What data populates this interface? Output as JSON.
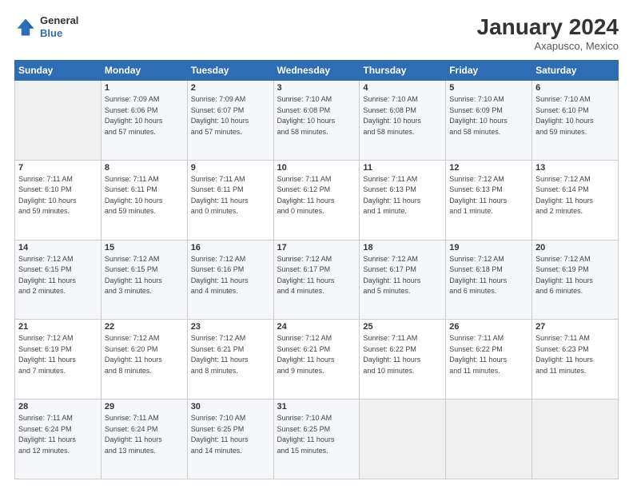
{
  "header": {
    "logo_general": "General",
    "logo_blue": "Blue",
    "month_title": "January 2024",
    "location": "Axapusco, Mexico"
  },
  "days_of_week": [
    "Sunday",
    "Monday",
    "Tuesday",
    "Wednesday",
    "Thursday",
    "Friday",
    "Saturday"
  ],
  "weeks": [
    [
      {
        "num": "",
        "info": ""
      },
      {
        "num": "1",
        "info": "Sunrise: 7:09 AM\nSunset: 6:06 PM\nDaylight: 10 hours\nand 57 minutes."
      },
      {
        "num": "2",
        "info": "Sunrise: 7:09 AM\nSunset: 6:07 PM\nDaylight: 10 hours\nand 57 minutes."
      },
      {
        "num": "3",
        "info": "Sunrise: 7:10 AM\nSunset: 6:08 PM\nDaylight: 10 hours\nand 58 minutes."
      },
      {
        "num": "4",
        "info": "Sunrise: 7:10 AM\nSunset: 6:08 PM\nDaylight: 10 hours\nand 58 minutes."
      },
      {
        "num": "5",
        "info": "Sunrise: 7:10 AM\nSunset: 6:09 PM\nDaylight: 10 hours\nand 58 minutes."
      },
      {
        "num": "6",
        "info": "Sunrise: 7:10 AM\nSunset: 6:10 PM\nDaylight: 10 hours\nand 59 minutes."
      }
    ],
    [
      {
        "num": "7",
        "info": "Sunrise: 7:11 AM\nSunset: 6:10 PM\nDaylight: 10 hours\nand 59 minutes."
      },
      {
        "num": "8",
        "info": "Sunrise: 7:11 AM\nSunset: 6:11 PM\nDaylight: 10 hours\nand 59 minutes."
      },
      {
        "num": "9",
        "info": "Sunrise: 7:11 AM\nSunset: 6:11 PM\nDaylight: 11 hours\nand 0 minutes."
      },
      {
        "num": "10",
        "info": "Sunrise: 7:11 AM\nSunset: 6:12 PM\nDaylight: 11 hours\nand 0 minutes."
      },
      {
        "num": "11",
        "info": "Sunrise: 7:11 AM\nSunset: 6:13 PM\nDaylight: 11 hours\nand 1 minute."
      },
      {
        "num": "12",
        "info": "Sunrise: 7:12 AM\nSunset: 6:13 PM\nDaylight: 11 hours\nand 1 minute."
      },
      {
        "num": "13",
        "info": "Sunrise: 7:12 AM\nSunset: 6:14 PM\nDaylight: 11 hours\nand 2 minutes."
      }
    ],
    [
      {
        "num": "14",
        "info": "Sunrise: 7:12 AM\nSunset: 6:15 PM\nDaylight: 11 hours\nand 2 minutes."
      },
      {
        "num": "15",
        "info": "Sunrise: 7:12 AM\nSunset: 6:15 PM\nDaylight: 11 hours\nand 3 minutes."
      },
      {
        "num": "16",
        "info": "Sunrise: 7:12 AM\nSunset: 6:16 PM\nDaylight: 11 hours\nand 4 minutes."
      },
      {
        "num": "17",
        "info": "Sunrise: 7:12 AM\nSunset: 6:17 PM\nDaylight: 11 hours\nand 4 minutes."
      },
      {
        "num": "18",
        "info": "Sunrise: 7:12 AM\nSunset: 6:17 PM\nDaylight: 11 hours\nand 5 minutes."
      },
      {
        "num": "19",
        "info": "Sunrise: 7:12 AM\nSunset: 6:18 PM\nDaylight: 11 hours\nand 6 minutes."
      },
      {
        "num": "20",
        "info": "Sunrise: 7:12 AM\nSunset: 6:19 PM\nDaylight: 11 hours\nand 6 minutes."
      }
    ],
    [
      {
        "num": "21",
        "info": "Sunrise: 7:12 AM\nSunset: 6:19 PM\nDaylight: 11 hours\nand 7 minutes."
      },
      {
        "num": "22",
        "info": "Sunrise: 7:12 AM\nSunset: 6:20 PM\nDaylight: 11 hours\nand 8 minutes."
      },
      {
        "num": "23",
        "info": "Sunrise: 7:12 AM\nSunset: 6:21 PM\nDaylight: 11 hours\nand 8 minutes."
      },
      {
        "num": "24",
        "info": "Sunrise: 7:12 AM\nSunset: 6:21 PM\nDaylight: 11 hours\nand 9 minutes."
      },
      {
        "num": "25",
        "info": "Sunrise: 7:11 AM\nSunset: 6:22 PM\nDaylight: 11 hours\nand 10 minutes."
      },
      {
        "num": "26",
        "info": "Sunrise: 7:11 AM\nSunset: 6:22 PM\nDaylight: 11 hours\nand 11 minutes."
      },
      {
        "num": "27",
        "info": "Sunrise: 7:11 AM\nSunset: 6:23 PM\nDaylight: 11 hours\nand 11 minutes."
      }
    ],
    [
      {
        "num": "28",
        "info": "Sunrise: 7:11 AM\nSunset: 6:24 PM\nDaylight: 11 hours\nand 12 minutes."
      },
      {
        "num": "29",
        "info": "Sunrise: 7:11 AM\nSunset: 6:24 PM\nDaylight: 11 hours\nand 13 minutes."
      },
      {
        "num": "30",
        "info": "Sunrise: 7:10 AM\nSunset: 6:25 PM\nDaylight: 11 hours\nand 14 minutes."
      },
      {
        "num": "31",
        "info": "Sunrise: 7:10 AM\nSunset: 6:25 PM\nDaylight: 11 hours\nand 15 minutes."
      },
      {
        "num": "",
        "info": ""
      },
      {
        "num": "",
        "info": ""
      },
      {
        "num": "",
        "info": ""
      }
    ]
  ]
}
